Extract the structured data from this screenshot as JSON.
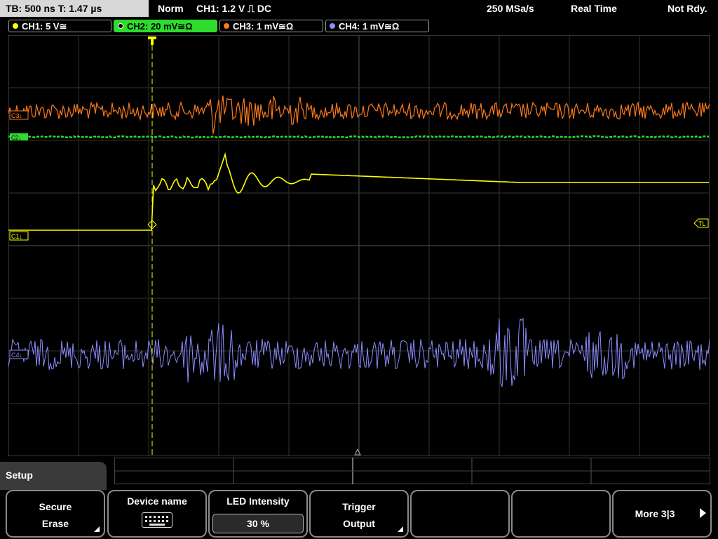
{
  "topbar": {
    "timebase": "TB: 500 ns   T: 1.47 µs",
    "mode": "Norm",
    "trigger": "CH1: 1.2 V ⎍ DC",
    "sample_rate": "250 MSa/s",
    "acq": "Real Time",
    "status": "Not Rdy."
  },
  "channels": [
    {
      "label": "CH1: 5 V≅",
      "color": "#ffff00",
      "active": false
    },
    {
      "label": "CH2: 20 mV≅Ω",
      "color": "#2ddc2d",
      "active": true
    },
    {
      "label": "CH3: 1 mV≅Ω",
      "color": "#ff7a1a",
      "active": false
    },
    {
      "label": "CH4: 1 mV≅Ω",
      "color": "#8c8cff",
      "active": false
    }
  ],
  "screen": {
    "ch3_marker": "C3↓",
    "ch2_marker": "C2↓",
    "ch1_marker": "C1↓",
    "ch4_marker": "C4↓",
    "trigger_level": "TL"
  },
  "setup_label": "Setup",
  "softkeys": {
    "secure_l1": "Secure",
    "secure_l2": "Erase",
    "device_name": "Device name",
    "led_label": "LED Intensity",
    "led_value": "30 %",
    "trigger_l1": "Trigger",
    "trigger_l2": "Output",
    "more": "More 3|3"
  },
  "icons": {
    "keyboard": "keyboard-icon",
    "more": "arrow-right-icon",
    "trigger_marker": "trigger-marker-icon"
  }
}
